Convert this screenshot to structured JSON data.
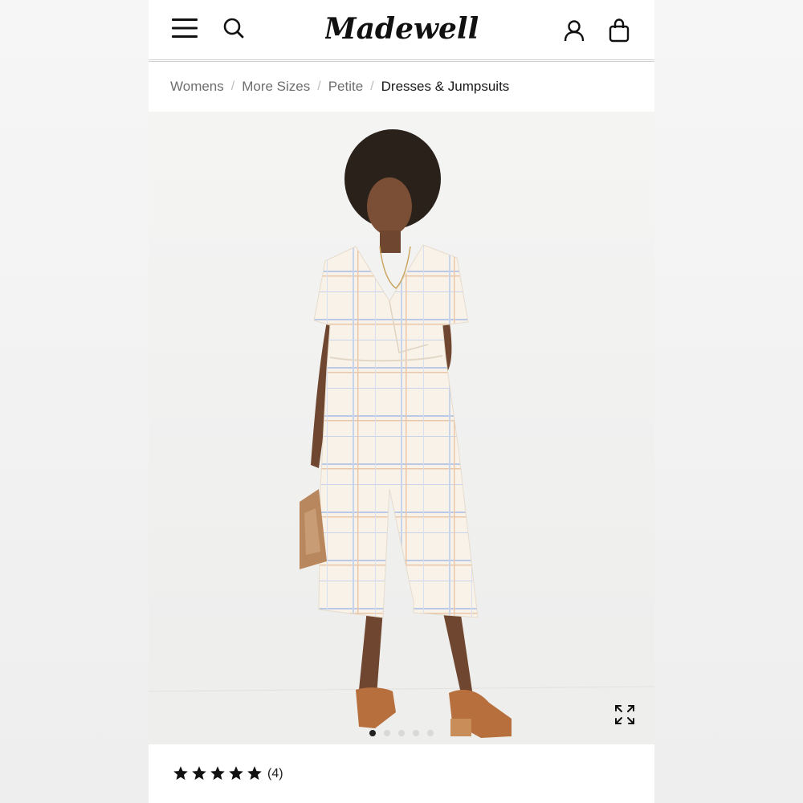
{
  "header": {
    "logo_text": "Madewell",
    "icons": [
      "menu-icon",
      "search-icon",
      "account-icon",
      "bag-icon"
    ]
  },
  "breadcrumb": {
    "items": [
      "Womens",
      "More Sizes",
      "Petite",
      "Dresses & Jumpsuits"
    ],
    "separator": "/"
  },
  "gallery": {
    "image_count": 5,
    "active_index": 0,
    "expand_icon": "expand-icon"
  },
  "rating": {
    "stars": 5,
    "review_count": "(4)"
  },
  "colors": {
    "text": "#1a1a1a",
    "muted": "#6e6e6e",
    "background": "#ffffff",
    "image_background": "#f1f1f1"
  }
}
